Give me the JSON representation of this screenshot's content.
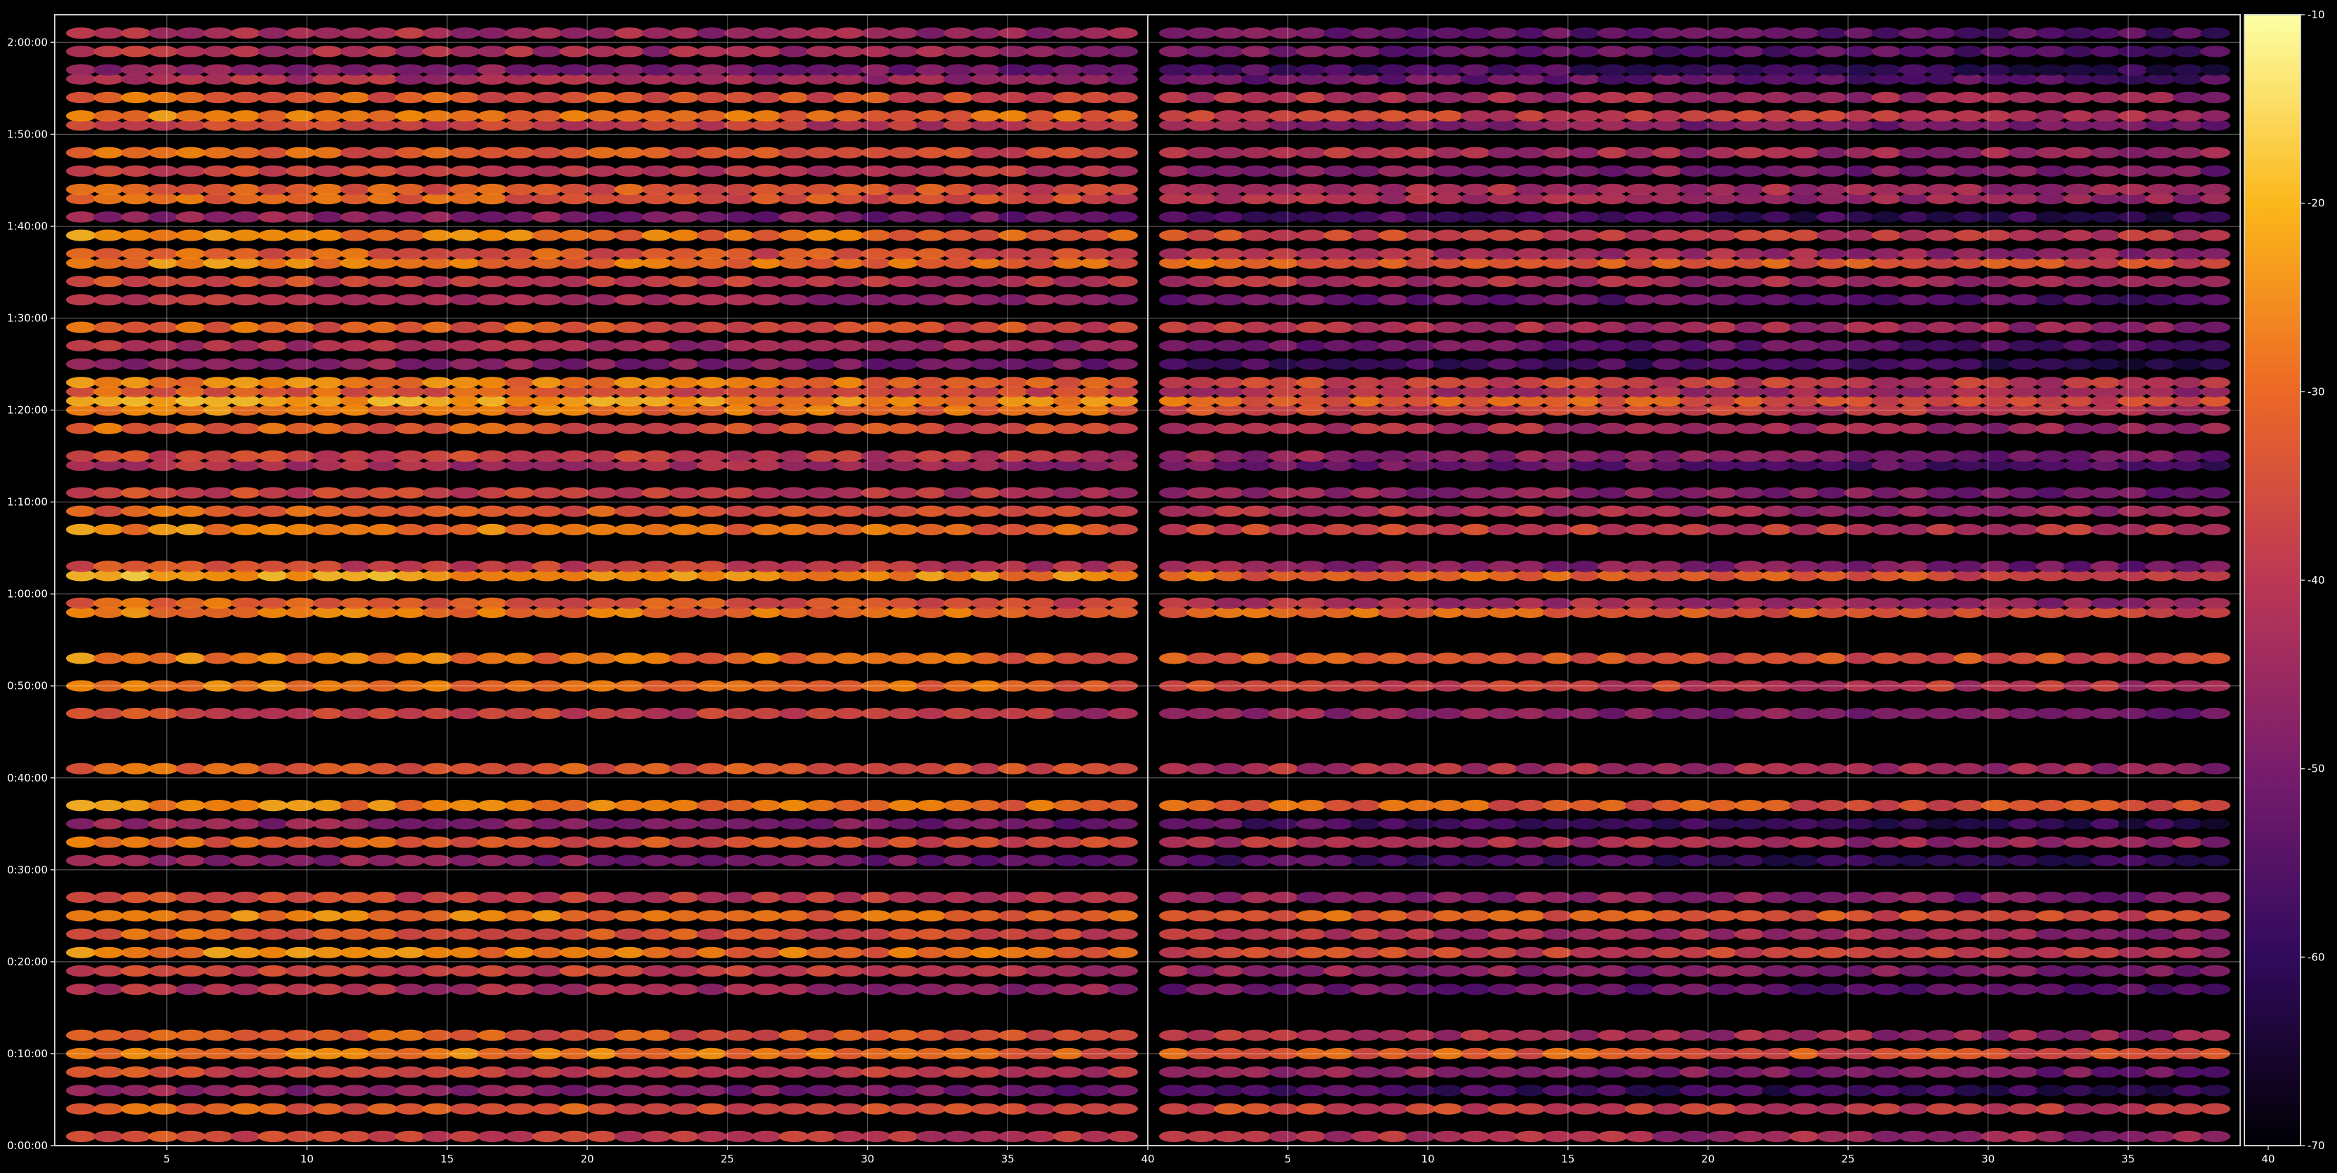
{
  "chart_data": {
    "type": "heatmap",
    "title": "",
    "xlabel": "",
    "ylabel": "",
    "colormap": "inferno",
    "background": "#000000",
    "grid": true,
    "y_ticks": [
      "0:00:00",
      "0:10:00",
      "0:20:00",
      "0:30:00",
      "0:40:00",
      "0:50:00",
      "1:00:00",
      "1:10:00",
      "1:20:00",
      "1:30:00",
      "1:40:00",
      "1:50:00",
      "2:00:00"
    ],
    "ylim_seconds": [
      0,
      7380
    ],
    "panels": [
      {
        "xlim": [
          1,
          40
        ],
        "x_ticks": [
          "5",
          "10",
          "15",
          "20",
          "25",
          "30",
          "35",
          "40"
        ],
        "x_tick_values": [
          5,
          10,
          15,
          20,
          25,
          30,
          35,
          40
        ]
      },
      {
        "xlim": [
          0,
          39
        ],
        "x_ticks": [
          "5",
          "10",
          "15",
          "20",
          "25",
          "30",
          "35",
          "40"
        ],
        "x_tick_values": [
          5,
          10,
          15,
          20,
          25,
          30,
          35,
          40
        ]
      }
    ],
    "colorbar": {
      "range": [
        -70,
        -10
      ],
      "ticks": [
        "-10",
        "-20",
        "-30",
        "-40",
        "-50",
        "-60",
        "-70"
      ],
      "tick_values": [
        -10,
        -20,
        -30,
        -40,
        -50,
        -60,
        -70
      ]
    },
    "row_bands": {
      "seconds": [
        60,
        240,
        360,
        480,
        600,
        720,
        1020,
        1140,
        1260,
        1380,
        1500,
        1620,
        1860,
        1980,
        2100,
        2220,
        2460,
        2820,
        3000,
        3180,
        3480,
        3540,
        3720,
        3780,
        4020,
        4140,
        4260,
        4440,
        4500,
        4680,
        4800,
        4860,
        4920,
        4980,
        5100,
        5220,
        5340,
        5520,
        5640,
        5760,
        5820,
        5940,
        6060,
        6180,
        6240,
        6360,
        6480,
        6660,
        6720,
        6840,
        6960,
        7020,
        7140,
        7260
      ],
      "left_dB": [
        -35,
        -30,
        -45,
        -35,
        -25,
        -30,
        -40,
        -35,
        -25,
        -30,
        -25,
        -35,
        -45,
        -30,
        -45,
        -25,
        -30,
        -35,
        -25,
        -25,
        -25,
        -30,
        -20,
        -35,
        -25,
        -30,
        -35,
        -40,
        -35,
        -30,
        -25,
        -20,
        -30,
        -25,
        -45,
        -40,
        -30,
        -40,
        -35,
        -25,
        -30,
        -25,
        -45,
        -30,
        -30,
        -35,
        -30,
        -35,
        -25,
        -30,
        -40,
        -45,
        -40,
        -40
      ],
      "right_dB": [
        -40,
        -35,
        -55,
        -45,
        -30,
        -40,
        -50,
        -45,
        -35,
        -40,
        -30,
        -45,
        -55,
        -40,
        -55,
        -30,
        -40,
        -45,
        -35,
        -30,
        -30,
        -40,
        -30,
        -45,
        -35,
        -40,
        -45,
        -50,
        -45,
        -40,
        -35,
        -30,
        -40,
        -35,
        -55,
        -50,
        -40,
        -50,
        -40,
        -30,
        -40,
        -35,
        -55,
        -40,
        -40,
        -45,
        -40,
        -45,
        -35,
        -40,
        -50,
        -55,
        -50,
        -50
      ]
    }
  }
}
